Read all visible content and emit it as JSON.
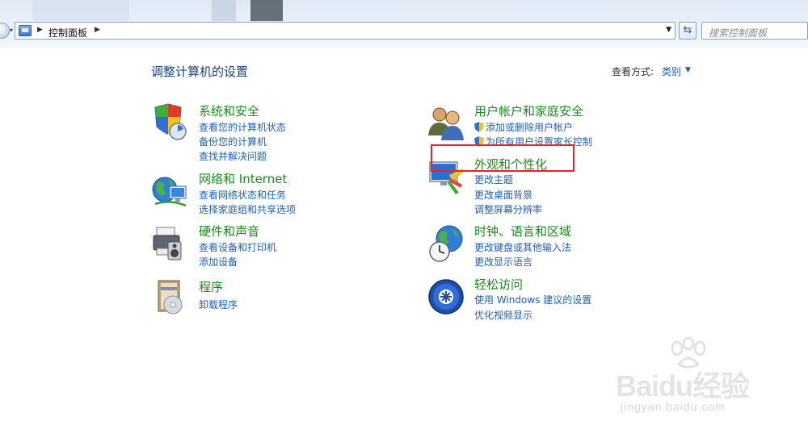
{
  "address_bar": {
    "crumb": "控制面板",
    "search_placeholder": "搜索控制面板"
  },
  "header": {
    "title": "调整计算机的设置",
    "view_by_label": "查看方式:",
    "view_by_value": "类别"
  },
  "categories": {
    "system_security": {
      "title": "系统和安全",
      "links": [
        "查看您的计算机状态",
        "备份您的计算机",
        "查找并解决问题"
      ]
    },
    "network": {
      "title": "网络和 Internet",
      "links": [
        "查看网络状态和任务",
        "选择家庭组和共享选项"
      ]
    },
    "hardware": {
      "title": "硬件和声音",
      "links": [
        "查看设备和打印机",
        "添加设备"
      ]
    },
    "programs": {
      "title": "程序",
      "links": [
        "卸载程序"
      ]
    },
    "user_accounts": {
      "title": "用户帐户和家庭安全",
      "links": [
        "添加或删除用户帐户",
        "为所有用户设置家长控制"
      ]
    },
    "appearance": {
      "title": "外观和个性化",
      "links": [
        "更改主题",
        "更改桌面背景",
        "调整屏幕分辨率"
      ]
    },
    "clock_language": {
      "title": "时钟、语言和区域",
      "links": [
        "更改键盘或其他输入法",
        "更改显示语言"
      ]
    },
    "ease_of_access": {
      "title": "轻松访问",
      "links": [
        "使用 Windows 建议的设置",
        "优化视频显示"
      ]
    }
  },
  "watermark": {
    "brand": "Baidu经验",
    "url": "jingyan.baidu.com"
  },
  "colors": {
    "category_title": "#1a8a1a",
    "link": "#1e5fb4",
    "heading": "#1f3f7a",
    "highlight": "#e8212a"
  }
}
